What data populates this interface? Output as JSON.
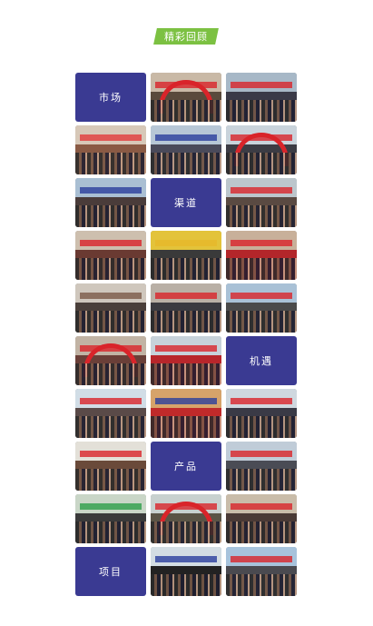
{
  "header": {
    "title": "精彩回顾"
  },
  "tiles": [
    {
      "type": "label",
      "text": "市场"
    },
    {
      "type": "photo",
      "name": "event-photo",
      "sky": "#c9b9a6",
      "ground": "#5a4a3c",
      "accent": "#d9242a",
      "arch": true
    },
    {
      "type": "photo",
      "name": "event-photo",
      "sky": "#a7b8c7",
      "ground": "#3a3a48",
      "accent": "#d9242a"
    },
    {
      "type": "photo",
      "name": "event-photo",
      "sky": "#d7c8b8",
      "ground": "#8a5a44",
      "accent": "#e23b3b"
    },
    {
      "type": "photo",
      "name": "event-photo",
      "sky": "#b7c7d6",
      "ground": "#4a4a5a",
      "accent": "#2b3f9c"
    },
    {
      "type": "photo",
      "name": "event-photo",
      "sky": "#c9d3db",
      "ground": "#3c3c44",
      "accent": "#d9242a",
      "arch": true
    },
    {
      "type": "photo",
      "name": "event-photo",
      "sky": "#a9bfd3",
      "ground": "#4a3c3a",
      "accent": "#2b3f9c"
    },
    {
      "type": "label",
      "text": "渠道"
    },
    {
      "type": "photo",
      "name": "event-photo",
      "sky": "#bcc6cc",
      "ground": "#5a4a42",
      "accent": "#d9242a"
    },
    {
      "type": "photo",
      "name": "event-photo",
      "sky": "#cdbfae",
      "ground": "#6a3a32",
      "accent": "#d9242a"
    },
    {
      "type": "photo",
      "name": "event-photo",
      "sky": "#e3c33a",
      "ground": "#3a3a3a",
      "accent": "#e6b82a"
    },
    {
      "type": "photo",
      "name": "event-photo",
      "sky": "#c8b09a",
      "ground": "#b3262a",
      "accent": "#d9242a"
    },
    {
      "type": "photo",
      "name": "event-photo",
      "sky": "#cfc7bd",
      "ground": "#4a3f3a",
      "accent": "#7a5a48"
    },
    {
      "type": "photo",
      "name": "event-photo",
      "sky": "#b9b0a6",
      "ground": "#3a3a40",
      "accent": "#d9242a"
    },
    {
      "type": "photo",
      "name": "event-photo",
      "sky": "#a9c1d6",
      "ground": "#4a4a4a",
      "accent": "#d9242a"
    },
    {
      "type": "photo",
      "name": "event-photo",
      "sky": "#c1b3a4",
      "ground": "#6a3f38",
      "accent": "#d9242a",
      "arch": true
    },
    {
      "type": "photo",
      "name": "event-photo",
      "sky": "#c7d2da",
      "ground": "#b8262b",
      "accent": "#d9242a"
    },
    {
      "type": "label",
      "text": "机遇"
    },
    {
      "type": "photo",
      "name": "event-photo",
      "sky": "#d1dde6",
      "ground": "#5a4a48",
      "accent": "#d9242a"
    },
    {
      "type": "photo",
      "name": "event-photo",
      "sky": "#d6a36a",
      "ground": "#c02a2a",
      "accent": "#2b3f9c"
    },
    {
      "type": "photo",
      "name": "event-photo",
      "sky": "#cfd8df",
      "ground": "#3a3a46",
      "accent": "#d9242a"
    },
    {
      "type": "photo",
      "name": "event-photo",
      "sky": "#e3e0d8",
      "ground": "#6a4a3a",
      "accent": "#d9242a"
    },
    {
      "type": "label",
      "text": "产品"
    },
    {
      "type": "photo",
      "name": "event-photo",
      "sky": "#c0ccd8",
      "ground": "#4a4c55",
      "accent": "#d9242a"
    },
    {
      "type": "photo",
      "name": "event-photo",
      "sky": "#c9d6c7",
      "ground": "#3a3a3a",
      "accent": "#2e9f4a"
    },
    {
      "type": "photo",
      "name": "event-photo",
      "sky": "#c8d1cf",
      "ground": "#5a5446",
      "accent": "#d9242a",
      "arch": true
    },
    {
      "type": "photo",
      "name": "event-photo",
      "sky": "#c9bca9",
      "ground": "#4a3a36",
      "accent": "#d9242a"
    },
    {
      "type": "label",
      "text": "项目"
    },
    {
      "type": "photo",
      "name": "event-photo",
      "sky": "#d3dde3",
      "ground": "#222222",
      "accent": "#2b3f9c"
    },
    {
      "type": "photo",
      "name": "event-photo",
      "sky": "#a7c3dc",
      "ground": "#4a4a50",
      "accent": "#d9242a"
    }
  ]
}
